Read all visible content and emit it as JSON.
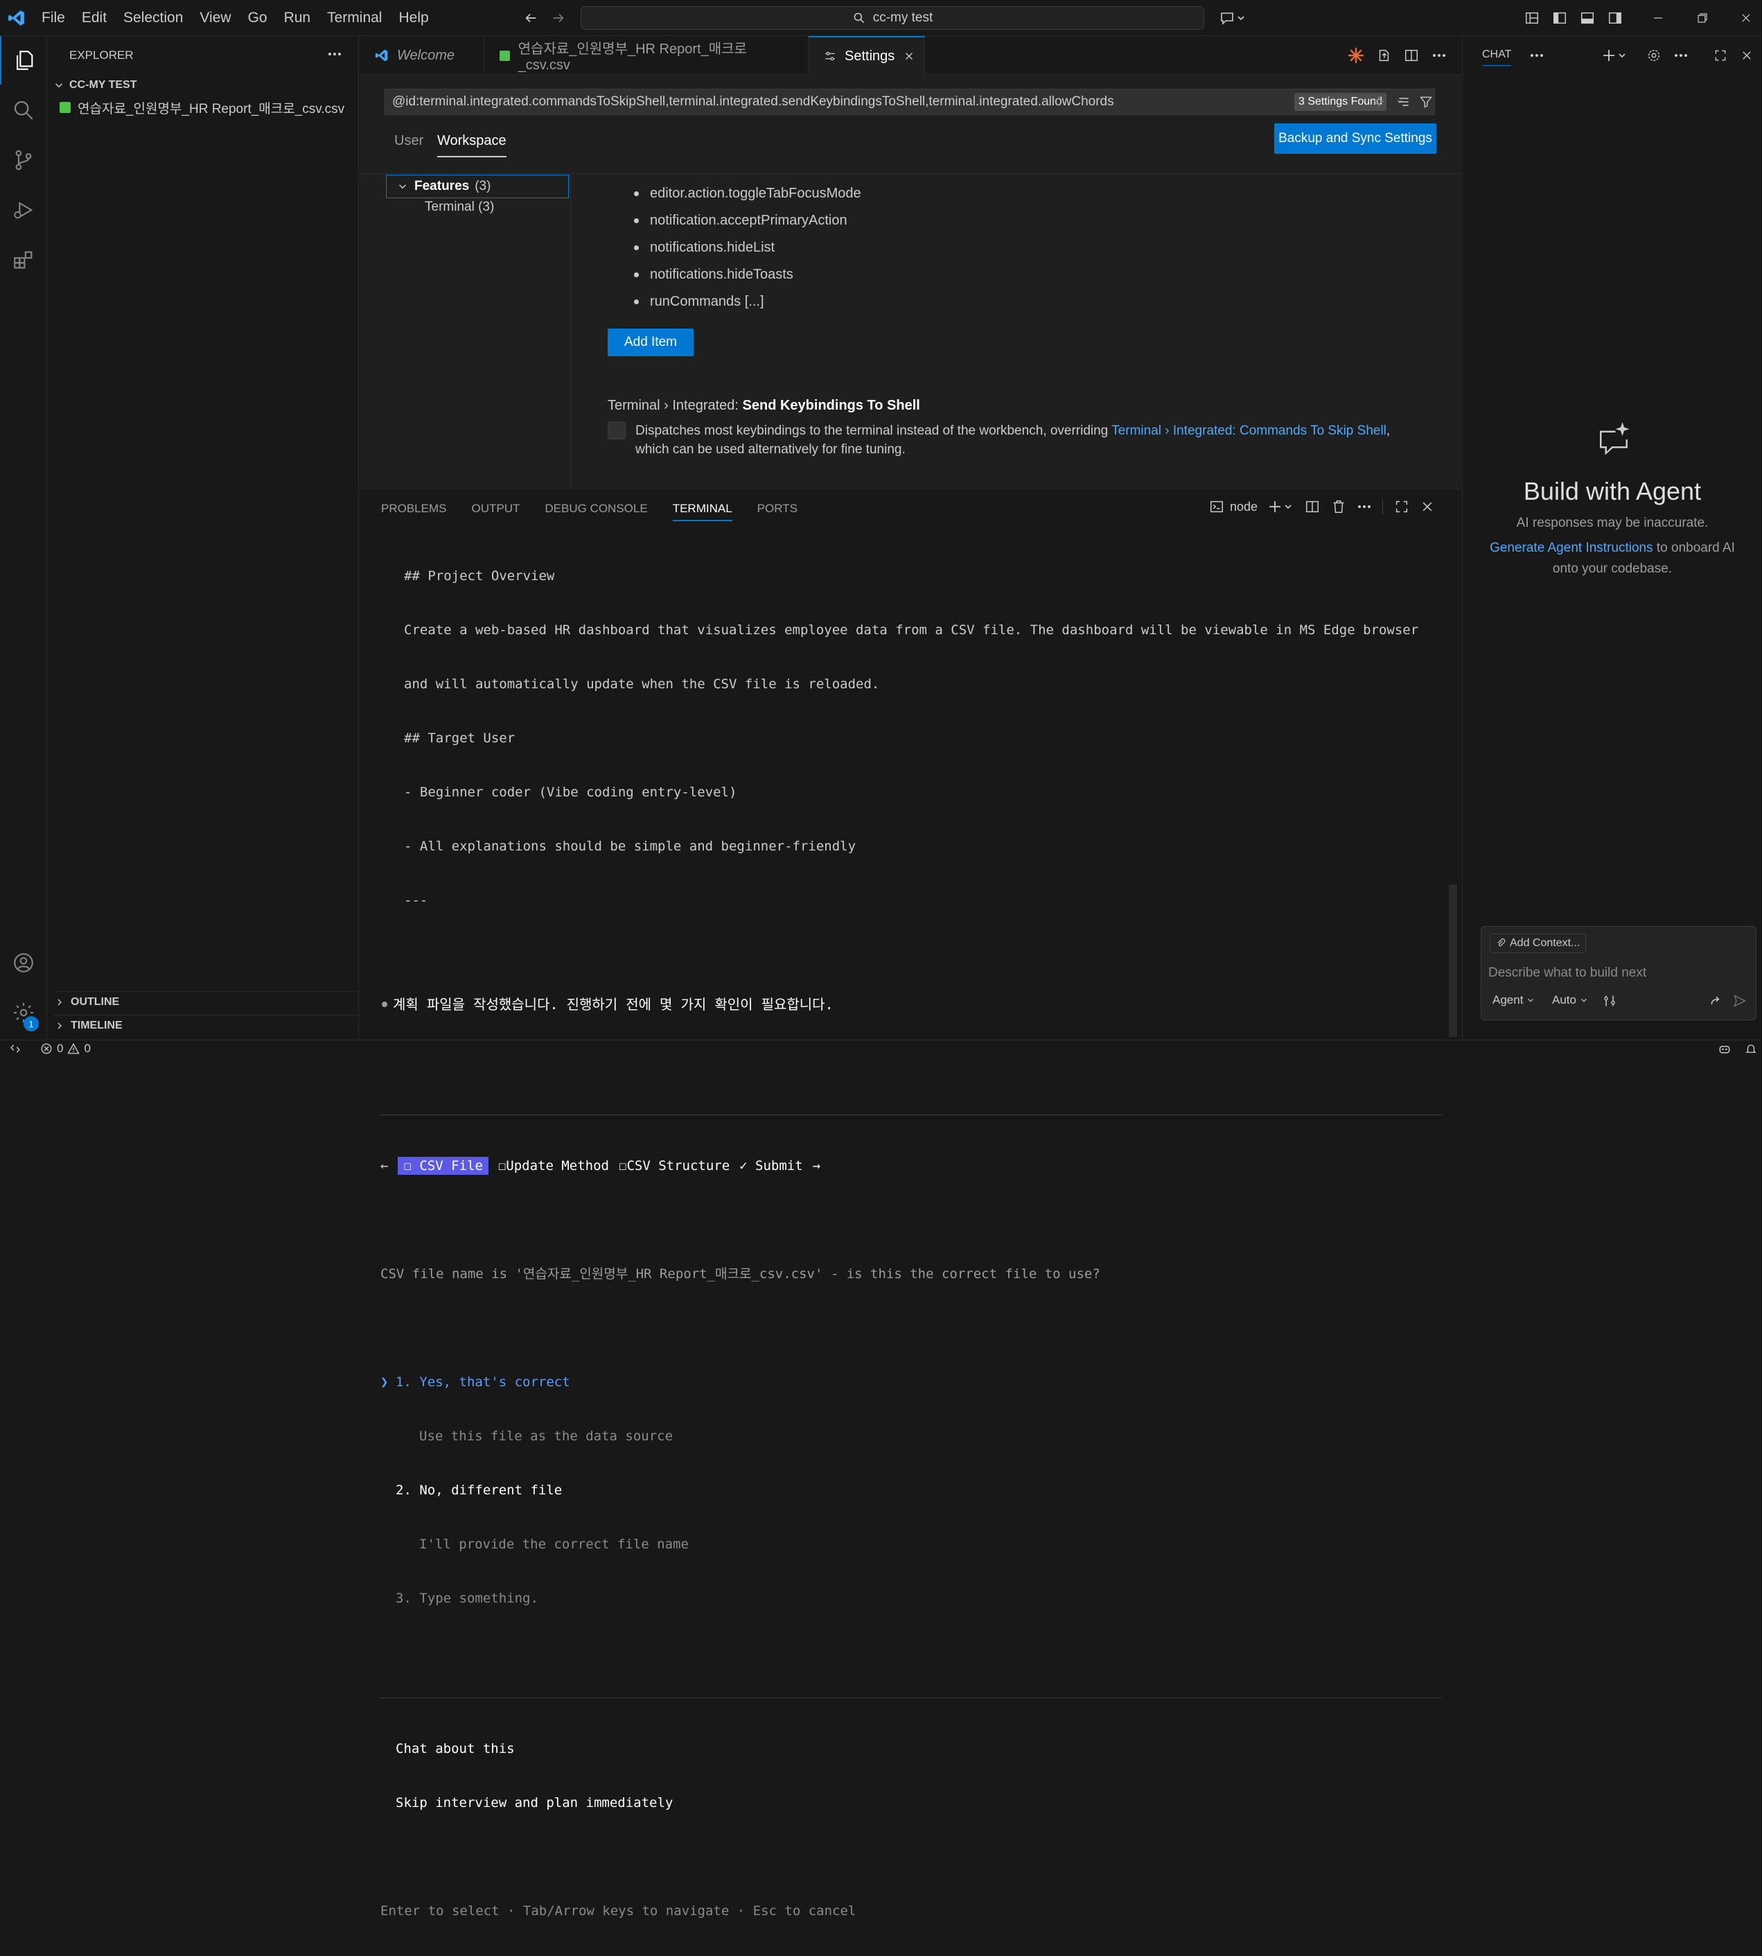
{
  "menu": {
    "file": "File",
    "edit": "Edit",
    "selection": "Selection",
    "view": "View",
    "go": "Go",
    "run": "Run",
    "terminal": "Terminal",
    "help": "Help"
  },
  "search": {
    "label": "cc-my test"
  },
  "explorer": {
    "title": "EXPLORER",
    "folder": "CC-MY TEST",
    "file": "연습자료_인원명부_HR Report_매크로_csv.csv",
    "outline": "OUTLINE",
    "timeline": "TIMELINE"
  },
  "tabs": [
    {
      "label": "Welcome"
    },
    {
      "label": "연습자료_인원명부_HR Report_매크로_csv.csv"
    },
    {
      "label": "Settings"
    }
  ],
  "settings": {
    "query": "@id:terminal.integrated.commandsToSkipShell,terminal.integrated.sendKeybindingsToShell,terminal.integrated.allowChords",
    "found": "3 Settings Found",
    "scope_user": "User",
    "scope_workspace": "Workspace",
    "backup_button": "Backup and Sync Settings",
    "toc_features": "Features",
    "toc_features_count": "(3)",
    "toc_terminal": "Terminal (3)",
    "list_items": [
      "editor.action.toggleTabFocusMode",
      "notification.acceptPrimaryAction",
      "notifications.hideList",
      "notifications.hideToasts",
      "runCommands [...]"
    ],
    "add_item": "Add Item",
    "setting_category": "Terminal › Integrated: ",
    "setting_name": "Send Keybindings To Shell",
    "desc_prefix": "Dispatches most keybindings to the terminal instead of the workbench, overriding ",
    "desc_link": "Terminal › Integrated: Commands To Skip Shell",
    "desc_suffix": ",",
    "desc_line2": "which can be used alternatively for fine tuning."
  },
  "panel": {
    "tabs": [
      "PROBLEMS",
      "OUTPUT",
      "DEBUG CONSOLE",
      "TERMINAL",
      "PORTS"
    ],
    "shell": "node"
  },
  "terminal": {
    "lines": [
      "## Project Overview",
      "Create a web-based HR dashboard that visualizes employee data from a CSV file. The dashboard will be viewable in MS Edge browser",
      "and will automatically update when the CSV file is reloaded.",
      "## Target User",
      "- Beginner coder (Vibe coding entry-level)",
      "- All explanations should be simple and beginner-friendly",
      "---"
    ],
    "status": "계획 파일을 작성했습니다. 진행하기 전에 몇 가지 확인이 필요합니다.",
    "nav_left": "←",
    "step1": "☐ CSV File",
    "step2": "☐Update Method",
    "step3": "☐CSV Structure",
    "step4": "✓ Submit",
    "nav_right": "→",
    "question": "CSV file name is '연습자료_인원명부_HR Report_매크로_csv.csv' - is this the correct file to use?",
    "cursor": "❯",
    "opt1": "1. Yes, that's correct",
    "opt1_desc": "Use this file as the data source",
    "opt2": "2. No, different file",
    "opt2_desc": "I'll provide the correct file name",
    "opt3": "3. Type something.",
    "chat_about": "Chat about this",
    "skip": "Skip interview and plan immediately",
    "help": "Enter to select · Tab/Arrow keys to navigate · Esc to cancel"
  },
  "chat": {
    "title": "CHAT",
    "heading": "Build with Agent",
    "disclaimer": "AI responses may be inaccurate.",
    "link": "Generate Agent Instructions",
    "link_suffix": " to onboard AI",
    "line2": "onto your codebase.",
    "add_context": "Add Context...",
    "placeholder": "Describe what to build next",
    "mode": "Agent",
    "model": "Auto"
  },
  "status": {
    "errors": "0",
    "warnings": "0",
    "badge": "1"
  },
  "colors": {
    "accent": "#0078d4",
    "link": "#4daafc",
    "csv_green": "#4ec24a",
    "claude": "#e86a3a"
  }
}
